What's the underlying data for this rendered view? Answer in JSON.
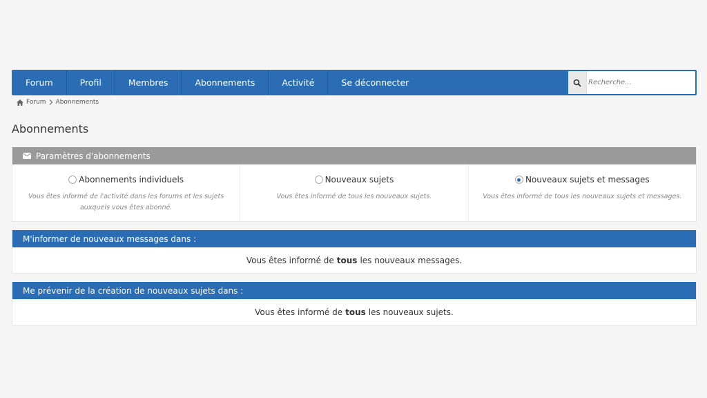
{
  "nav": {
    "items": [
      "Forum",
      "Profil",
      "Membres",
      "Abonnements",
      "Activité",
      "Se déconnecter"
    ]
  },
  "search": {
    "placeholder": "Recherche..."
  },
  "breadcrumb": {
    "home": "Forum",
    "current": "Abonnements"
  },
  "page_title": "Abonnements",
  "settings_panel": {
    "title": "Paramètres d'abonnements",
    "options": [
      {
        "label": "Abonnements individuels",
        "desc": "Vous êtes informé de l'activité dans les forums et les sujets auxquels vous êtes abonné.",
        "checked": false
      },
      {
        "label": "Nouveaux sujets",
        "desc": "Vous êtes informé de tous les nouveaux sujets.",
        "checked": false
      },
      {
        "label": "Nouveaux sujets et messages",
        "desc": "Vous êtes informé de tous les nouveaux sujets et messages.",
        "checked": true
      }
    ]
  },
  "messages_panel": {
    "title": "M'informer de nouveaux messages dans :",
    "pre": "Vous êtes informé de",
    "bold": "tous",
    "post": "les nouveaux messages."
  },
  "topics_panel": {
    "title": "Me prévenir de la création de nouveaux sujets dans :",
    "pre": "Vous êtes informé de",
    "bold": "tous",
    "post": "les nouveaux sujets."
  },
  "colors": {
    "primary": "#2a6db5",
    "header_gray": "#9a9a9a",
    "background": "#f5f5f5"
  }
}
